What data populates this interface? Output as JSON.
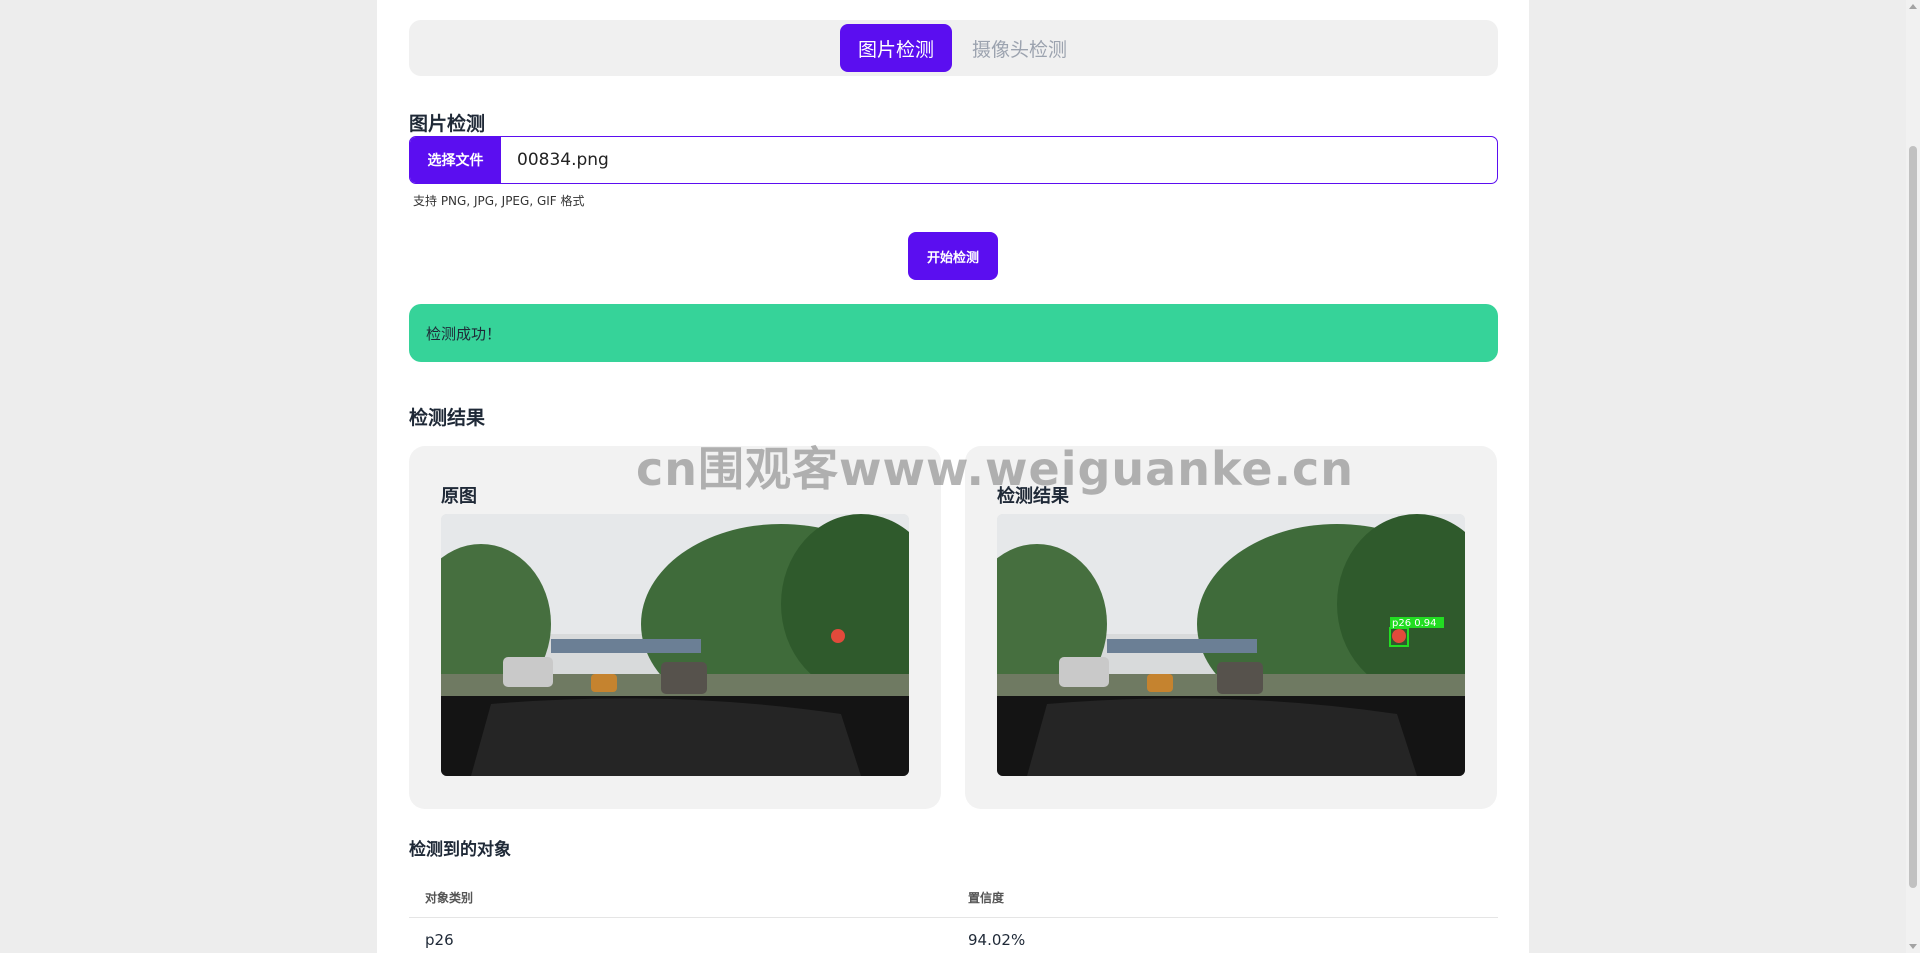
{
  "tabs": [
    {
      "label": "图片检测",
      "active": true
    },
    {
      "label": "摄像头检测",
      "active": false
    }
  ],
  "upload": {
    "section_title": "图片检测",
    "choose_file_label": "选择文件",
    "file_name": "00834.png",
    "hint": "支持 PNG, JPG, JPEG, GIF 格式"
  },
  "start_button_label": "开始检测",
  "alert": {
    "message": "检测成功！",
    "color": "#36d399"
  },
  "results": {
    "title": "检测结果",
    "original_label": "原图",
    "detected_label": "检测结果",
    "detection_box_label": "p26  0.94"
  },
  "objects": {
    "title": "检测到的对象",
    "columns": [
      "对象类别",
      "置信度"
    ],
    "rows": [
      {
        "class": "p26",
        "confidence": "94.02%"
      }
    ]
  },
  "watermark": "cn围观客www.weiguanke.cn",
  "colors": {
    "accent": "#5b0ef0",
    "success": "#36d399"
  }
}
